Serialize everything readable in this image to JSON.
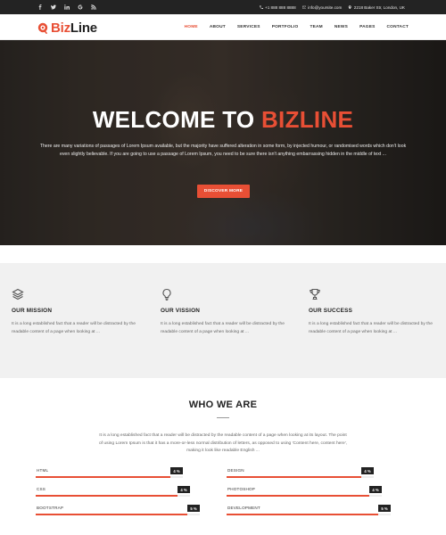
{
  "topbar": {
    "social": [
      "facebook-icon",
      "twitter-icon",
      "linkedin-icon",
      "google-icon",
      "rss-icon"
    ],
    "phone": "+1 888 888 8888",
    "email": "info@yoursite.com",
    "address": "2218 Baker Str, London, UK"
  },
  "header": {
    "logo_prefix": "Biz",
    "logo_suffix": "Line",
    "nav": [
      "HOME",
      "ABOUT",
      "SERVICES",
      "PORTFOLIO",
      "TEAM",
      "NEWS",
      "PAGES",
      "CONTACT"
    ],
    "active_nav": "HOME"
  },
  "hero": {
    "title_prefix": "WELCOME TO ",
    "title_accent": "BIZLINE",
    "text": "There are many variations of passages of Lorem Ipsum available, but the majority have suffered alteration in some form, by injected humour, or randomised words which don't look even slightly believable. If you are going to use a passage of Lorem Ipsum, you need to be sure there isn't anything embarrassing hidden in the middle of text ...",
    "button": "DISCOVER MORE"
  },
  "features": [
    {
      "icon": "layers-icon",
      "title": "OUR MISSION",
      "text": "It is a long established fact that a reader will be distracted by the readable content of a page when looking at ..."
    },
    {
      "icon": "lightbulb-icon",
      "title": "OUR VISSION",
      "text": "It is a long established fact that a reader will be distracted by the readable content of a page when looking at ..."
    },
    {
      "icon": "trophy-icon",
      "title": "OUR SUCCESS",
      "text": "It is a long established fact that a reader will be distracted by the readable content of a page when looking at ..."
    }
  ],
  "who": {
    "title": "WHO WE ARE",
    "intro": "It is a long established fact that a reader will be distracted by the readable content of a page when looking at its layout. The point of using Lorem Ipsum is that it has a more-or-less normal distribution of letters, as opposed to using 'Content here, content here', making it look like readable English ...",
    "skills": [
      {
        "name": "HTML",
        "percent": 4,
        "label": "4 %"
      },
      {
        "name": "DESIGN",
        "percent": 4,
        "label": "4 %"
      },
      {
        "name": "CSS",
        "percent": 4,
        "label": "4 %"
      },
      {
        "name": "PHOTOSHOP",
        "percent": 4,
        "label": "4 %"
      },
      {
        "name": "BOOTSTRAP",
        "percent": 5,
        "label": "5 %"
      },
      {
        "name": "DEVELOPMENT",
        "percent": 5,
        "label": "5 %"
      }
    ]
  },
  "colors": {
    "accent": "#e84f35",
    "topbar": "#232323",
    "features_bg": "#f1f1f1",
    "badge": "#222222"
  }
}
